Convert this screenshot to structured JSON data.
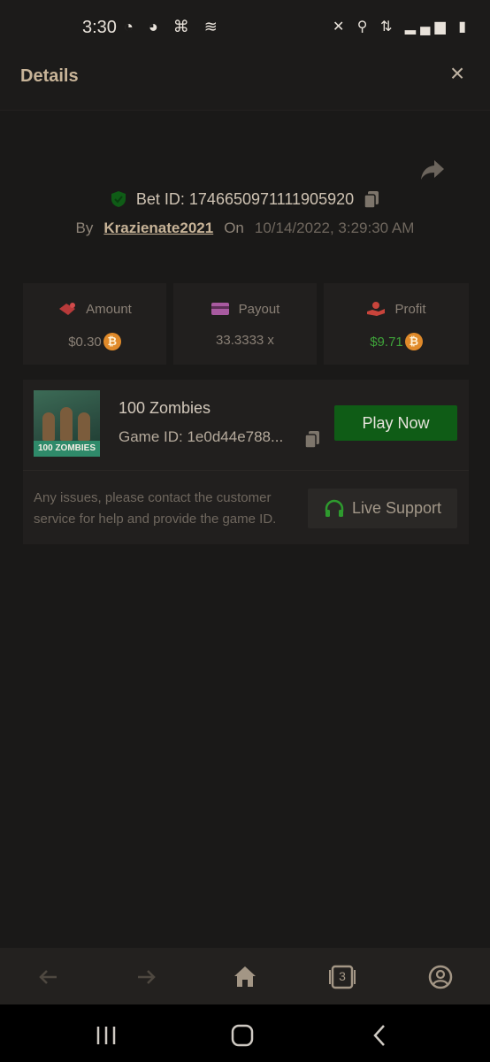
{
  "status_bar": {
    "time": "3:30",
    "left_icons": "◔ ◕ ⌘ ≋",
    "right_icons": "✕ ⚲ ⇅ ▂▄▆ ▮"
  },
  "header": {
    "title": "Details",
    "close_icon": "×"
  },
  "bet": {
    "id_label": "Bet ID: 1746650971111905920",
    "by_label": "By",
    "username": "Krazienate2021",
    "on_label": "On",
    "date": "10/14/2022, 3:29:30 AM"
  },
  "stats": [
    {
      "label": "Amount",
      "value": "$0.30"
    },
    {
      "label": "Payout",
      "value": "33.3333 x"
    },
    {
      "label": "Profit",
      "value": "$9.71"
    }
  ],
  "game": {
    "thumb_text": "100 ZOMBIES",
    "name": "100 Zombies",
    "game_id": "Game ID: 1e0d44e788...",
    "play_label": "Play Now",
    "notice": "Any issues, please contact the customer service for help and provide the game ID.",
    "support_label": "Live Support"
  },
  "bottom_nav": {
    "tabs_count": "3"
  },
  "colors": {
    "accent": "#0f5c16",
    "gold": "#c8b498",
    "profit": "#3fa33a",
    "coin": "#e08a2a"
  }
}
